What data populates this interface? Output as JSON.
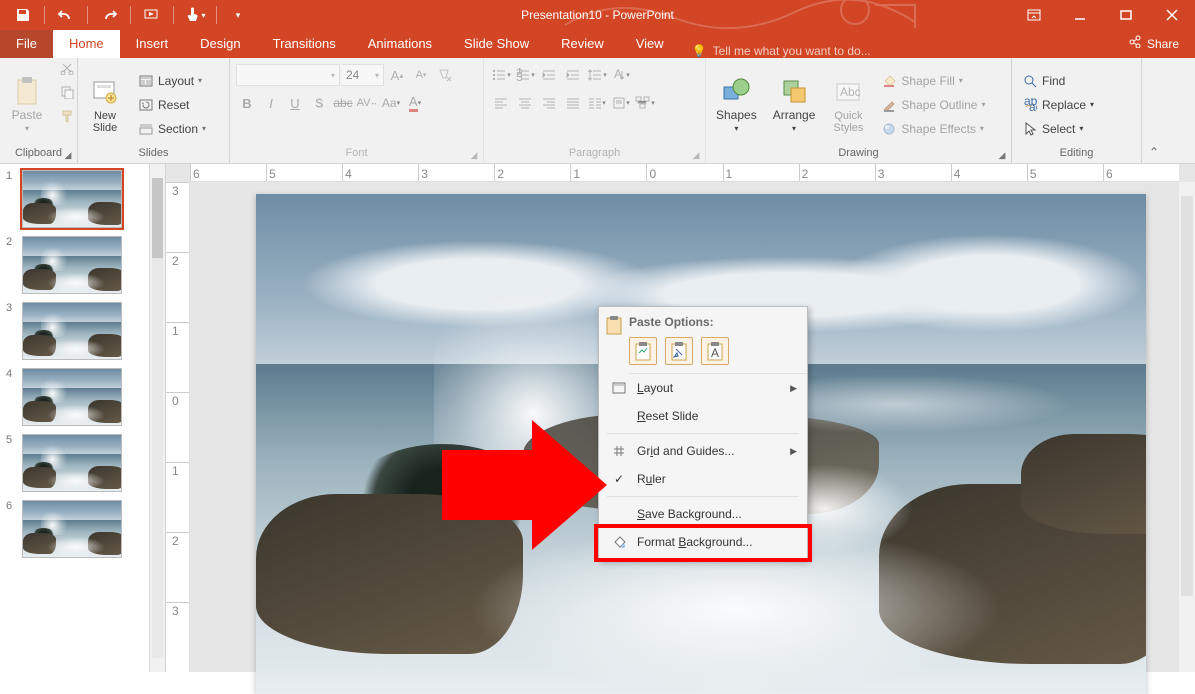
{
  "title": "Presentation10 - PowerPoint",
  "tabs": {
    "file": "File",
    "home": "Home",
    "insert": "Insert",
    "design": "Design",
    "transitions": "Transitions",
    "animations": "Animations",
    "slideshow": "Slide Show",
    "review": "Review",
    "view": "View"
  },
  "tellme_placeholder": "Tell me what you want to do...",
  "share": "Share",
  "ribbon": {
    "clipboard": {
      "label": "Clipboard",
      "paste": "Paste"
    },
    "slides": {
      "label": "Slides",
      "new": "New\nSlide",
      "layout": "Layout",
      "reset": "Reset",
      "section": "Section"
    },
    "font": {
      "label": "Font",
      "size": "24"
    },
    "paragraph": {
      "label": "Paragraph"
    },
    "drawing": {
      "label": "Drawing",
      "shapes": "Shapes",
      "arrange": "Arrange",
      "quick": "Quick\nStyles",
      "fill": "Shape Fill",
      "outline": "Shape Outline",
      "effects": "Shape Effects"
    },
    "editing": {
      "label": "Editing",
      "find": "Find",
      "replace": "Replace",
      "select": "Select"
    }
  },
  "slides": [
    1,
    2,
    3,
    4,
    5,
    6
  ],
  "selected_slide": 1,
  "ruler_h": [
    "6",
    "5",
    "4",
    "3",
    "2",
    "1",
    "0",
    "1",
    "2",
    "3",
    "4",
    "5",
    "6"
  ],
  "ruler_v": [
    "3",
    "2",
    "1",
    "0",
    "1",
    "2",
    "3"
  ],
  "context_menu": {
    "paste_header": "Paste Options:",
    "layout": "Layout",
    "reset": "Reset Slide",
    "grid": "Grid and Guides...",
    "ruler": "Ruler",
    "savebg": "Save Background...",
    "formatbg": "Format Background..."
  }
}
